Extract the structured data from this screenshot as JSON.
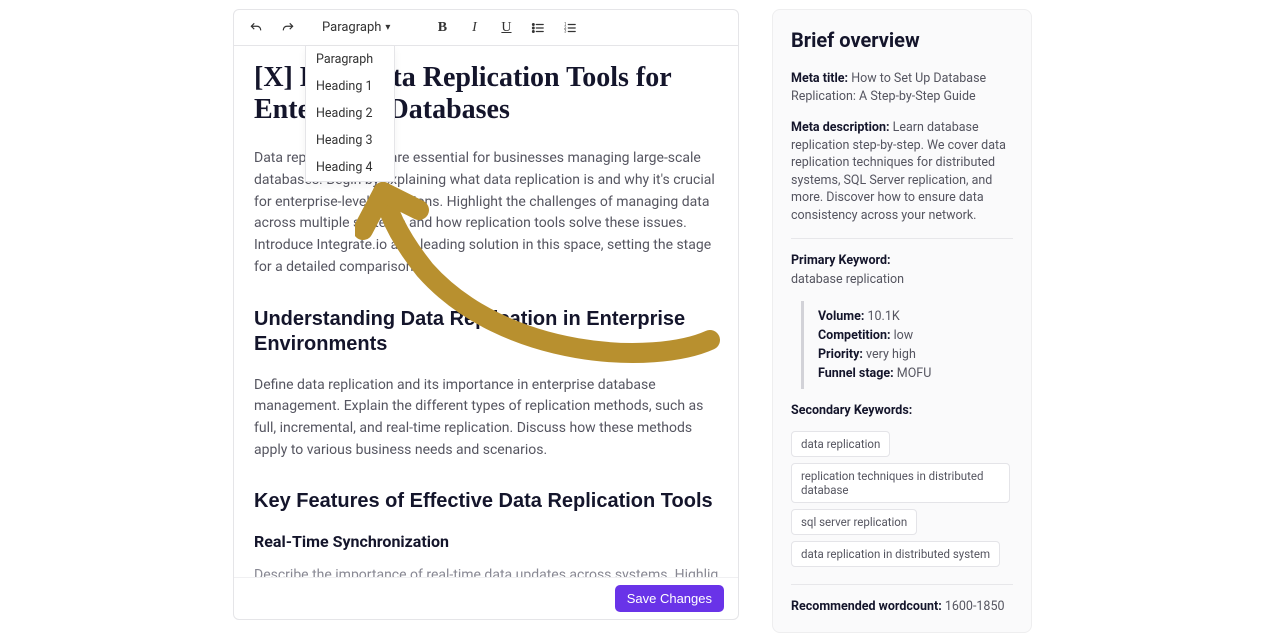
{
  "toolbar": {
    "format_label": "Paragraph",
    "dropdown": [
      "Paragraph",
      "Heading 1",
      "Heading 2",
      "Heading 3",
      "Heading 4"
    ],
    "bold": "B",
    "italic": "I",
    "underline": "U"
  },
  "document": {
    "title": "[X] Best Data Replication Tools for Enterprise Databases",
    "intro": "Data replication tools are essential for businesses managing large-scale databases. Begin by explaining what data replication is and why it's crucial for enterprise-level operations. Highlight the challenges of managing data across multiple systems and how replication tools solve these issues. Introduce Integrate.io as a leading solution in this space, setting the stage for a detailed comparison.",
    "h2a": "Understanding Data Replication in Enterprise Environments",
    "p2": "Define data replication and its importance in enterprise database management. Explain the different types of replication methods, such as full, incremental, and real-time replication. Discuss how these methods apply to various business needs and scenarios.",
    "h2b": "Key Features of Effective Data Replication Tools",
    "h3a": "Real-Time Synchronization",
    "p3": "Describe the importance of real-time data updates across systems. Highlight"
  },
  "save_label": "Save Changes",
  "brief": {
    "heading": "Brief overview",
    "meta_title_label": "Meta title:",
    "meta_title": "How to Set Up Database Replication: A Step-by-Step Guide",
    "meta_desc_label": "Meta description:",
    "meta_desc": "Learn database replication step-by-step. We cover data replication techniques for distributed systems, SQL Server replication, and more. Discover how to ensure data consistency across your network.",
    "primary_kw_label": "Primary Keyword:",
    "primary_kw": "database replication",
    "stats": {
      "volume_label": "Volume:",
      "volume": "10.1K",
      "competition_label": "Competition:",
      "competition": "low",
      "priority_label": "Priority:",
      "priority": "very high",
      "funnel_label": "Funnel stage:",
      "funnel": "MOFU"
    },
    "secondary_label": "Secondary Keywords:",
    "secondary": [
      "data replication",
      "replication techniques in distributed database",
      "sql server replication",
      "data replication in distributed system"
    ],
    "wc_label": "Recommended wordcount:",
    "wc": "1600-1850"
  }
}
